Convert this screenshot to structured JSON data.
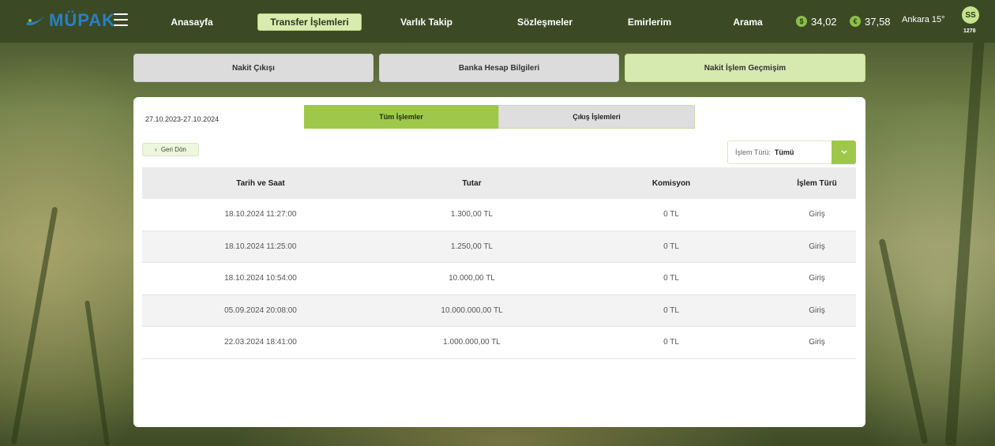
{
  "brand": {
    "name": "MÜPAK"
  },
  "nav": {
    "items": [
      {
        "label": "Anasayfa"
      },
      {
        "label": "Transfer İşlemleri",
        "active": true
      },
      {
        "label": "Varlık Takip"
      },
      {
        "label": "Sözleşmeler"
      },
      {
        "label": "Emirlerim"
      },
      {
        "label": "Arama"
      }
    ],
    "rates": [
      {
        "icon": "dollar-coin-icon",
        "symbol": "$",
        "value": "34,02"
      },
      {
        "icon": "euro-coin-icon",
        "symbol": "€",
        "value": "37,58"
      }
    ],
    "weather": "Ankara 15°",
    "user": {
      "initials": "SS",
      "id": "1278"
    }
  },
  "top_tabs": [
    {
      "label": "Nakit Çıkışı"
    },
    {
      "label": "Banka Hesap Bilgileri"
    },
    {
      "label": "Nakit İşlem Geçmişim",
      "active": true
    }
  ],
  "panel": {
    "date_range": "27.10.2023-27.10.2024",
    "segments": [
      {
        "label": "Tüm İşlemler",
        "active": true
      },
      {
        "label": "Çıkış İşlemleri"
      }
    ],
    "back_label": "Geri Dön",
    "filter": {
      "label": "İşlem Türü:",
      "value": "Tümü"
    }
  },
  "table": {
    "columns": [
      "Tarih ve Saat",
      "Tutar",
      "Komisyon",
      "İşlem Türü"
    ],
    "rows": [
      [
        "18.10.2024 11:27:00",
        "1.300,00 TL",
        "0 TL",
        "Giriş"
      ],
      [
        "18.10.2024 11:25:00",
        "1.250,00 TL",
        "0 TL",
        "Giriş"
      ],
      [
        "18.10.2024 10:54:00",
        "10.000,00 TL",
        "0 TL",
        "Giriş"
      ],
      [
        "05.09.2024 20:08:00",
        "10.000.000,00 TL",
        "0 TL",
        "Giriş"
      ],
      [
        "22.03.2024 18:41:00",
        "1.000.000,00 TL",
        "0 TL",
        "Giriş"
      ]
    ]
  },
  "colors": {
    "accent": "#9ec84a",
    "accent_light": "#d6eab0",
    "topbar": "#3b4a24",
    "logo": "#2a7fc4"
  }
}
